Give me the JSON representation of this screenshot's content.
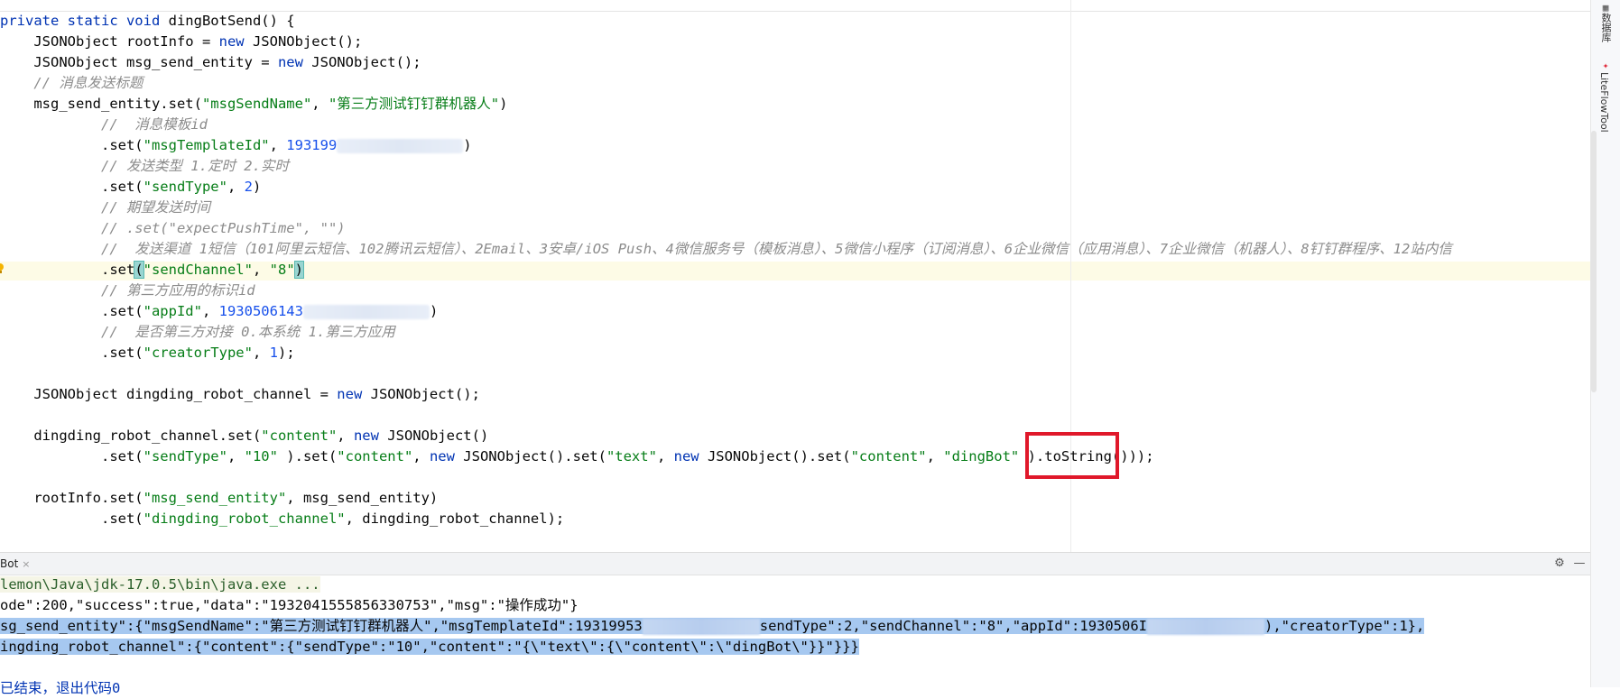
{
  "editor": {
    "lines": [
      [
        [
          "kw",
          "private static void "
        ],
        [
          "id",
          "dingBotSend() {"
        ]
      ],
      [
        [
          "id",
          "    JSONObject rootInfo = "
        ],
        [
          "kw",
          "new "
        ],
        [
          "id",
          "JSONObject();"
        ]
      ],
      [
        [
          "id",
          "    JSONObject msg_send_entity = "
        ],
        [
          "kw",
          "new "
        ],
        [
          "id",
          "JSONObject();"
        ]
      ],
      [
        [
          "cmt",
          "    // 消息发送标题"
        ]
      ],
      [
        [
          "id",
          "    msg_send_entity.set("
        ],
        [
          "str",
          "\"msgSendName\""
        ],
        [
          "id",
          ", "
        ],
        [
          "str",
          "\"第三方测试钉钉群机器人\""
        ],
        [
          "id",
          ")"
        ]
      ],
      [
        [
          "cmt",
          "            //  消息模板id"
        ]
      ],
      [
        [
          "id",
          "            .set("
        ],
        [
          "str",
          "\"msgTemplateId\""
        ],
        [
          "id",
          ", "
        ],
        [
          "num",
          "193199"
        ],
        [
          "blur",
          ""
        ],
        [
          "id",
          ")"
        ]
      ],
      [
        [
          "cmt",
          "            // 发送类型 1.定时 2.实时"
        ]
      ],
      [
        [
          "id",
          "            .set("
        ],
        [
          "str",
          "\"sendType\""
        ],
        [
          "id",
          ", "
        ],
        [
          "num",
          "2"
        ],
        [
          "id",
          ")"
        ]
      ],
      [
        [
          "cmt",
          "            // 期望发送时间"
        ]
      ],
      [
        [
          "cmt",
          "            // .set(\"expectPushTime\", \"\")"
        ]
      ],
      [
        [
          "cmt",
          "            //  发送渠道 1短信（101阿里云短信、102腾讯云短信）、2Email、3安卓/iOS Push、4微信服务号（模板消息）、5微信小程序（订阅消息）、6企业微信（应用消息）、7企业微信（机器人）、8钉钉群程序、12站内信"
        ]
      ],
      [
        [
          "id",
          "            .set"
        ],
        [
          "match",
          "("
        ],
        [
          "str",
          "\"sendChannel\""
        ],
        [
          "id",
          ", "
        ],
        [
          "str",
          "\"8\""
        ],
        [
          "match",
          ")"
        ]
      ],
      [
        [
          "cmt",
          "            // 第三方应用的标识id"
        ]
      ],
      [
        [
          "id",
          "            .set("
        ],
        [
          "str",
          "\"appId\""
        ],
        [
          "id",
          ", "
        ],
        [
          "num",
          "1930506143"
        ],
        [
          "blur",
          ""
        ],
        [
          "id",
          ")"
        ]
      ],
      [
        [
          "cmt",
          "            //  是否第三方对接 0.本系统 1.第三方应用"
        ]
      ],
      [
        [
          "id",
          "            .set("
        ],
        [
          "str",
          "\"creatorType\""
        ],
        [
          "id",
          ", "
        ],
        [
          "num",
          "1"
        ],
        [
          "id",
          ");"
        ]
      ],
      [
        [
          "id",
          ""
        ]
      ],
      [
        [
          "id",
          "    JSONObject dingding_robot_channel = "
        ],
        [
          "kw",
          "new "
        ],
        [
          "id",
          "JSONObject();"
        ]
      ],
      [
        [
          "id",
          ""
        ]
      ],
      [
        [
          "id",
          "    dingding_robot_channel.set("
        ],
        [
          "str",
          "\"content\""
        ],
        [
          "id",
          ", "
        ],
        [
          "kw",
          "new "
        ],
        [
          "id",
          "JSONObject()"
        ]
      ],
      [
        [
          "id",
          "            .set("
        ],
        [
          "str",
          "\"sendType\""
        ],
        [
          "id",
          ", "
        ],
        [
          "str",
          "\"10\""
        ],
        [
          "id",
          " ).set("
        ],
        [
          "str",
          "\"content\""
        ],
        [
          "id",
          ", "
        ],
        [
          "kw",
          "new "
        ],
        [
          "id",
          "JSONObject().set("
        ],
        [
          "str",
          "\"text\""
        ],
        [
          "id",
          ", "
        ],
        [
          "kw",
          "new "
        ],
        [
          "id",
          "JSONObject().set("
        ],
        [
          "str",
          "\"content\""
        ],
        [
          "id",
          ", "
        ],
        [
          "str",
          "\"dingBot\""
        ],
        [
          "id",
          " ).toString()));"
        ]
      ],
      [
        [
          "id",
          ""
        ]
      ],
      [
        [
          "id",
          "    rootInfo.set("
        ],
        [
          "str",
          "\"msg_send_entity\""
        ],
        [
          "id",
          ", msg_send_entity)"
        ]
      ],
      [
        [
          "id",
          "            .set("
        ],
        [
          "str",
          "\"dingding_robot_channel\""
        ],
        [
          "id",
          ", dingding_robot_channel);"
        ]
      ]
    ]
  },
  "right_panel": {
    "tool1": "数据库",
    "tool2": "LiteFlowTool"
  },
  "run": {
    "tab_label": "Bot",
    "tab_close": "×",
    "settings_icon": "⚙",
    "minimize_icon": "—",
    "console": [
      {
        "cls": "cpath",
        "parts": [
          [
            "t",
            "lemon\\Java\\jdk-17.0.5\\bin\\java.exe ..."
          ]
        ]
      },
      {
        "cls": "",
        "parts": [
          [
            "t",
            "ode\":200,\"success\":true,\"data\":\"1932041555856330753\",\"msg\":\"操作成功\"}"
          ]
        ]
      },
      {
        "cls": "sel",
        "parts": [
          [
            "t",
            "sg_send_entity\":{\"msgSendName\":\"第三方测试钉钉群机器人\",\"msgTemplateId\":19319953"
          ],
          [
            "blur",
            ""
          ],
          [
            "t",
            "sendType\":2,\"sendChannel\":\"8\",\"appId\":1930506I"
          ],
          [
            "blur",
            ""
          ],
          [
            "t",
            "),\"creatorType\":1},"
          ]
        ]
      },
      {
        "cls": "sel",
        "parts": [
          [
            "t",
            "ingding_robot_channel\":{\"content\":{\"sendType\":\"10\",\"content\":\"{\\\"text\\\":{\\\"content\\\":\\\"dingBot\\\"}}\"}}}"
          ]
        ]
      },
      {
        "cls": "",
        "parts": [
          [
            "t",
            ""
          ]
        ]
      },
      {
        "cls": "exit",
        "parts": [
          [
            "t",
            "已结束，退出代码0"
          ]
        ]
      }
    ]
  }
}
